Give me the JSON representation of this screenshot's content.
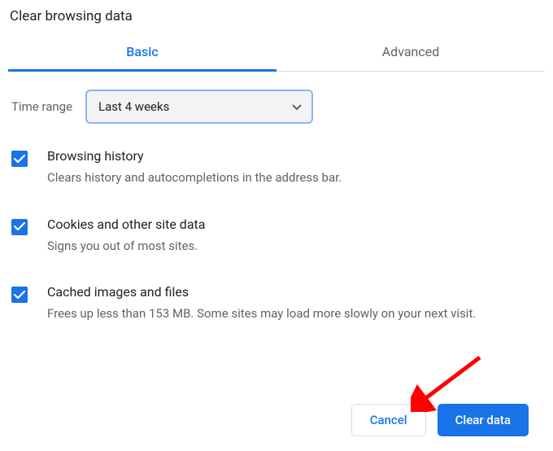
{
  "title": "Clear browsing data",
  "tabs": {
    "basic": "Basic",
    "advanced": "Advanced"
  },
  "time_range": {
    "label": "Time range",
    "selected": "Last 4 weeks"
  },
  "options": [
    {
      "title": "Browsing history",
      "desc": "Clears history and autocompletions in the address bar.",
      "checked": true
    },
    {
      "title": "Cookies and other site data",
      "desc": "Signs you out of most sites.",
      "checked": true
    },
    {
      "title": "Cached images and files",
      "desc": "Frees up less than 153 MB. Some sites may load more slowly on your next visit.",
      "checked": true
    }
  ],
  "buttons": {
    "cancel": "Cancel",
    "clear": "Clear data"
  },
  "colors": {
    "accent": "#1a73e8",
    "text_secondary": "#5f6368",
    "arrow": "#ff0000"
  }
}
